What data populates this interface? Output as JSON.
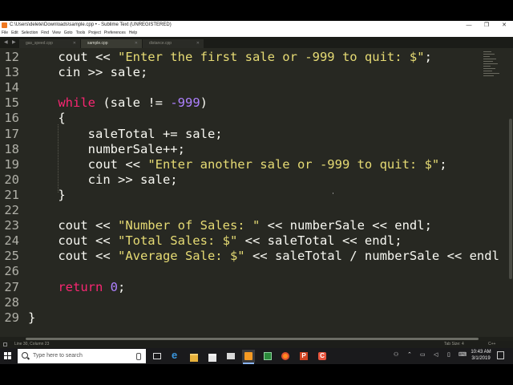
{
  "window": {
    "title": "C:\\Users\\delete\\Downloads\\sample.cpp • - Sublime Text (UNREGISTERED)",
    "minimize": "—",
    "maximize": "❐",
    "close": "✕"
  },
  "menu": [
    "File",
    "Edit",
    "Selection",
    "Find",
    "View",
    "Goto",
    "Tools",
    "Project",
    "Preferences",
    "Help"
  ],
  "tabs": [
    {
      "label": "gas_speed.cpp",
      "active": false
    },
    {
      "label": "sample.cpp",
      "active": true
    },
    {
      "label": "distance.cpp",
      "active": false
    }
  ],
  "editor": {
    "lines": [
      {
        "no": "12",
        "code": [
          [
            "    cout << ",
            ""
          ],
          [
            "\"Enter the first sale or -999 to quit: $\"",
            "str"
          ],
          [
            ";",
            ""
          ]
        ]
      },
      {
        "no": "13",
        "code": [
          [
            "    cin >> sale;",
            ""
          ]
        ]
      },
      {
        "no": "14",
        "code": []
      },
      {
        "no": "15",
        "code": [
          [
            "    ",
            ""
          ],
          [
            "while",
            "kw"
          ],
          [
            " (sale != ",
            ""
          ],
          [
            "-999",
            "num"
          ],
          [
            ")",
            ""
          ]
        ]
      },
      {
        "no": "16",
        "code": [
          [
            "    {",
            ""
          ]
        ]
      },
      {
        "no": "17",
        "code": [
          [
            "        saleTotal += sale;",
            ""
          ]
        ]
      },
      {
        "no": "18",
        "code": [
          [
            "        numberSale++;",
            ""
          ]
        ]
      },
      {
        "no": "19",
        "code": [
          [
            "        cout << ",
            ""
          ],
          [
            "\"Enter another sale or -999 to quit: $\"",
            "str"
          ],
          [
            ";",
            ""
          ]
        ]
      },
      {
        "no": "20",
        "code": [
          [
            "        cin >> sale;",
            ""
          ]
        ]
      },
      {
        "no": "21",
        "code": [
          [
            "    }",
            ""
          ]
        ]
      },
      {
        "no": "22",
        "code": []
      },
      {
        "no": "23",
        "code": [
          [
            "    cout << ",
            ""
          ],
          [
            "\"Number of Sales: \"",
            "str"
          ],
          [
            " << numberSale << endl;",
            ""
          ]
        ]
      },
      {
        "no": "24",
        "code": [
          [
            "    cout << ",
            ""
          ],
          [
            "\"Total Sales: $\"",
            "str"
          ],
          [
            " << saleTotal << endl;",
            ""
          ]
        ]
      },
      {
        "no": "25",
        "code": [
          [
            "    cout << ",
            ""
          ],
          [
            "\"Average Sale: $\"",
            "str"
          ],
          [
            " << saleTotal / numberSale << endl",
            ""
          ]
        ]
      },
      {
        "no": "26",
        "code": []
      },
      {
        "no": "27",
        "code": [
          [
            "    ",
            ""
          ],
          [
            "return",
            "kw"
          ],
          [
            " ",
            ""
          ],
          [
            "0",
            "num"
          ],
          [
            ";",
            ""
          ]
        ]
      },
      {
        "no": "28",
        "code": []
      },
      {
        "no": "29",
        "code": [
          [
            "}",
            ""
          ]
        ]
      }
    ]
  },
  "status": {
    "position": "Line 30, Column 23",
    "tab_size": "Tab Size: 4",
    "language": "C++"
  },
  "taskbar": {
    "search_placeholder": "Type here to search",
    "time": "10:43 AM",
    "date": "3/1/2019"
  },
  "colors": {
    "editor_bg": "#272822",
    "keyword": "#f92672",
    "string": "#e6db74",
    "number": "#ae81ff",
    "text": "#f8f8f2"
  }
}
